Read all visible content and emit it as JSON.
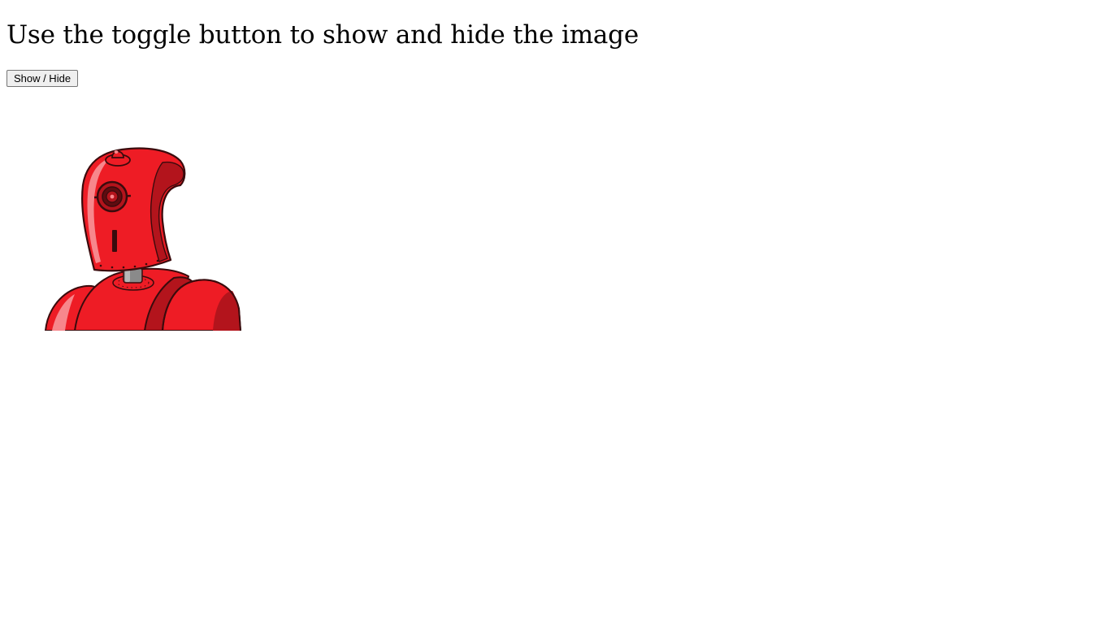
{
  "page": {
    "heading": "Use the toggle button to show and hide the image"
  },
  "controls": {
    "toggle_label": "Show / Hide"
  },
  "image": {
    "alt": "Red cartoon robot",
    "icon": "robot-illustration",
    "visible": true,
    "colors": {
      "body_red": "#ee1c25",
      "shade_red": "#b3141c",
      "highlight_pink": "#f7878c",
      "outline": "#3a0b0d",
      "neck_gray": "#8a8a8a"
    }
  }
}
